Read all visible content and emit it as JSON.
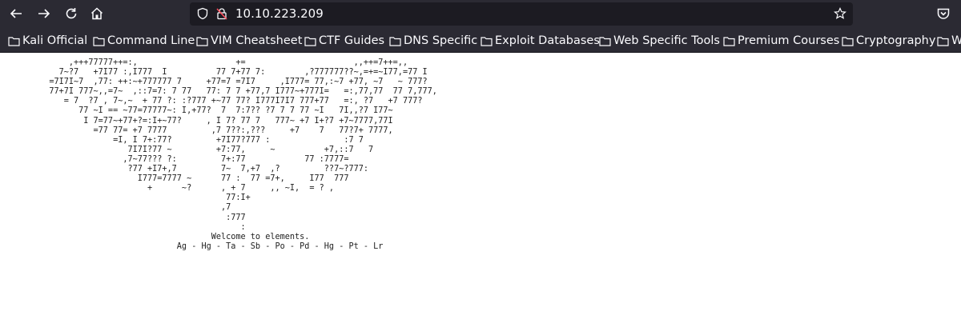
{
  "browser": {
    "url": "10.10.223.209",
    "icons": {
      "back": "arrow-left-icon",
      "forward": "arrow-right-icon",
      "reload": "reload-icon",
      "home": "home-icon",
      "shield": "shield-icon",
      "lock": "insecure-lock-icon",
      "star": "star-icon",
      "pocket": "pocket-icon",
      "folder": "folder-icon"
    },
    "bookmarks": [
      "Kali Official",
      "Command Line",
      "VIM Cheatsheet",
      "CTF Guides",
      "DNS Specific",
      "Exploit Databases",
      "Web Specific Tools",
      "Premium Courses",
      "Cryptography",
      "W"
    ]
  },
  "page": {
    "art": "              ,+++77777++=:,                    +=                      ,,++=7++=,,\n            7~?7   +7I77 :,I777  I          77 7+77 7:        ,?777777??~,=+=~I77,=77 I\n          =7I7I~7  ,77: ++:~+777777 7     +77=7 =7I7     ,I777= 77,:~7 +77, ~7   ~ 777?\n          77+7I 777~,,=7~  ,::7=7: 7 77   77: 7 7 +77,7 I777~+777I=   =:,77,77  77 7,777,\n             = 7  ?7 , 7~,~  + 77 ?: :?777 +~77 77? I777I7I7 777+77   =:, ?7   +7 777?\n                77 ~I == ~77=77777~: I,+77?  7  7:7?? ?7 7 7 77 ~I   7I,,?7 I77~\n                 I 7=77~+77+?=:I+~77?     , I 7? 77 7   777~ +7 I+?7 +7~7777,77I\n                   =77 77= +7 7777         ,7 7??:,???     +7    7   77?7+ 7777,\n                       =I, I 7+:77?         +7I77?777 :               :7 7\n                          7I7I?77 ~         +7:77,     ~          +7,::7   7\n                         ,7~77??? ?:         7+:77            77 :7777=\n                          ?77 +I7+,7         7~  7,+7  ,?         ??7~?777:\n                            I777=7777 ~      77 :  77 =7+,     I77  777\n                              +      ~?      , + 7     ,, ~I,  = ? ,\n                                              77:I+\n                                             ,7\n                                              :777\n                                                 :\n                                           Welcome to elements.\n                                    Ag - Hg - Ta - Sb - Po - Pd - Hg - Pt - Lr"
  }
}
